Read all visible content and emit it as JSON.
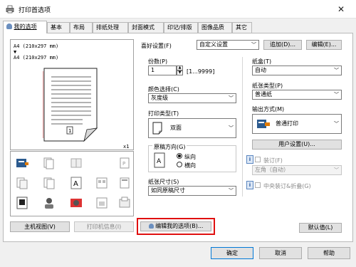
{
  "window": {
    "title": "打印首选项"
  },
  "tabs": [
    "我的选项",
    "基本",
    "布局",
    "排纸处理",
    "封面模式",
    "印记/排版",
    "图像品质",
    "其它"
  ],
  "preview": {
    "line1": "A4 (210x297 mm)",
    "line2": "A4 (210x297 mm)",
    "copies_badge": "x1"
  },
  "left_buttons": {
    "main_view": "主机视图(V)",
    "printer_info": "打印机信息(I)"
  },
  "favorite": {
    "label": "喜好设置(F)",
    "value": "自定义设置",
    "add": "追加(D)...",
    "edit": "编辑(E)..."
  },
  "copies": {
    "label": "份数(P)",
    "value": "1",
    "range": "[1...9999]"
  },
  "color": {
    "label": "颜色选择(C)",
    "value": "灰度级"
  },
  "print_type": {
    "label": "打印类型(T)",
    "value": "双面"
  },
  "orientation": {
    "label": "原稿方向(G)",
    "portrait": "纵向",
    "landscape": "横向",
    "selected": "portrait"
  },
  "paper_size": {
    "label": "纸张尺寸(S)",
    "value": "如同原稿尺寸"
  },
  "tray": {
    "label": "纸盒(T)",
    "value": "自动"
  },
  "paper_type": {
    "label": "纸张类型(P)",
    "value": "普通纸"
  },
  "output": {
    "label": "输出方式(M)",
    "value": "普通打印",
    "user_settings": "用户设置(U)..."
  },
  "binding": {
    "label": "装订(F)",
    "value": "左角（自动）"
  },
  "fold": {
    "label": "中央装订&折叠(G)"
  },
  "edit_my_options": "编辑我的选项(B)...",
  "defaults": "默认值(L)",
  "dialog_buttons": {
    "ok": "确定",
    "cancel": "取消",
    "help": "帮助"
  },
  "colors": {
    "accent": "#0078d7",
    "highlight": "#e01010"
  }
}
